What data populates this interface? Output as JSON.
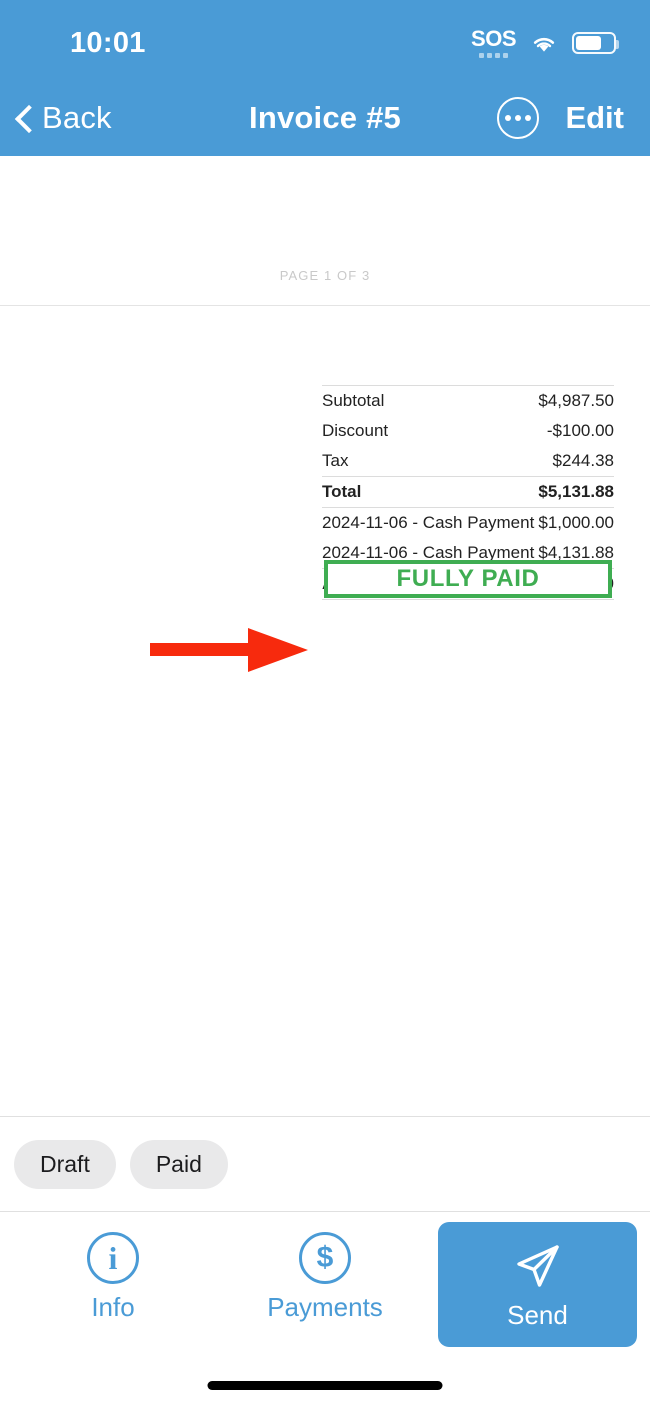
{
  "status_bar": {
    "time": "10:01",
    "sos_label": "SOS",
    "wifi_icon": "wifi-icon",
    "battery_icon": "battery-icon"
  },
  "nav_bar": {
    "back_label": "Back",
    "back_icon": "chevron-left-icon",
    "title": "Invoice #5",
    "more_icon": "more-ellipsis-icon",
    "edit_label": "Edit"
  },
  "document": {
    "page_label": "PAGE 1 OF 3",
    "totals": [
      {
        "label": "Subtotal",
        "value": "$4,987.50",
        "bold": false,
        "rule_above": true
      },
      {
        "label": "Discount",
        "value": "-$100.00",
        "bold": false,
        "rule_above": false
      },
      {
        "label": "Tax",
        "value": "$244.38",
        "bold": false,
        "rule_above": false
      },
      {
        "label": "Total",
        "value": "$5,131.88",
        "bold": true,
        "rule_above": true
      },
      {
        "label": "2024-11-06 - Cash Payment",
        "value": "$1,000.00",
        "bold": false,
        "rule_above": true
      },
      {
        "label": "2024-11-06 - Cash Payment",
        "value": "$4,131.88",
        "bold": false,
        "rule_above": false
      },
      {
        "label": "Amount Due",
        "value": "$0.00",
        "bold": true,
        "rule_above": true
      }
    ],
    "paid_badge": {
      "label": "FULLY PAID",
      "color": "#3fad52"
    },
    "annotation": {
      "type": "arrow",
      "color": "#f72a0d",
      "points_to": "paid-badge"
    }
  },
  "chips": [
    {
      "label": "Draft"
    },
    {
      "label": "Paid"
    }
  ],
  "toolbar": {
    "info": {
      "label": "Info",
      "icon": "info-circle-icon"
    },
    "payments": {
      "label": "Payments",
      "icon": "dollar-circle-icon"
    },
    "send": {
      "label": "Send",
      "icon": "paper-plane-icon",
      "color": "#4a9bd6"
    }
  },
  "colors": {
    "header_blue": "#4a9bd6",
    "paid_green": "#3fad52",
    "annotation_red": "#f72a0d",
    "chip_gray": "#e9e9ea"
  }
}
